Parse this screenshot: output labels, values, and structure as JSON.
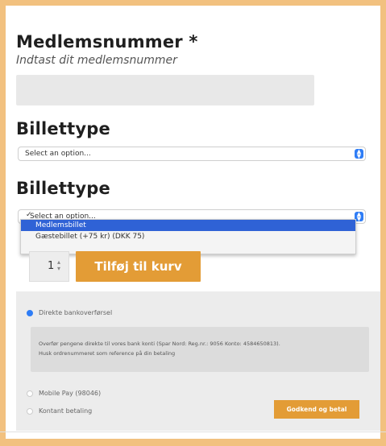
{
  "membership": {
    "title": "Medlemsnummer *",
    "subtitle": "Indtast dit medlemsnummer",
    "input_value": ""
  },
  "ticket_type_1": {
    "title": "Billettype",
    "select_value": "Select an option..."
  },
  "ticket_type_2": {
    "title": "Billettype",
    "select_value": "Select an option...",
    "options": [
      {
        "label": "Select an option...",
        "checked": true
      },
      {
        "label": "Medlemsbillet",
        "highlighted": true
      },
      {
        "label": "Gæstebillet (+75 kr) (DKK 75)"
      }
    ]
  },
  "cart": {
    "quantity": "1",
    "add_button_label": "Tilføj til kurv"
  },
  "payment": {
    "methods": [
      {
        "label": "Direkte bankoverførsel",
        "selected": true
      },
      {
        "label": "Mobile Pay (98046)",
        "selected": false
      },
      {
        "label": "Kontant betaling",
        "selected": false
      }
    ],
    "info_line_1": "Overfør pengene direkte til vores bank konti (Spar Nord: Reg.nr.: 9056 Konto: 4584650813).",
    "info_line_2": "Husk ordrenummeret som reference på din betaling",
    "submit_label": "Godkend og betal"
  },
  "colors": {
    "frame": "#f2c17f",
    "accent": "#e39c36",
    "select_blue": "#2f7df6"
  }
}
